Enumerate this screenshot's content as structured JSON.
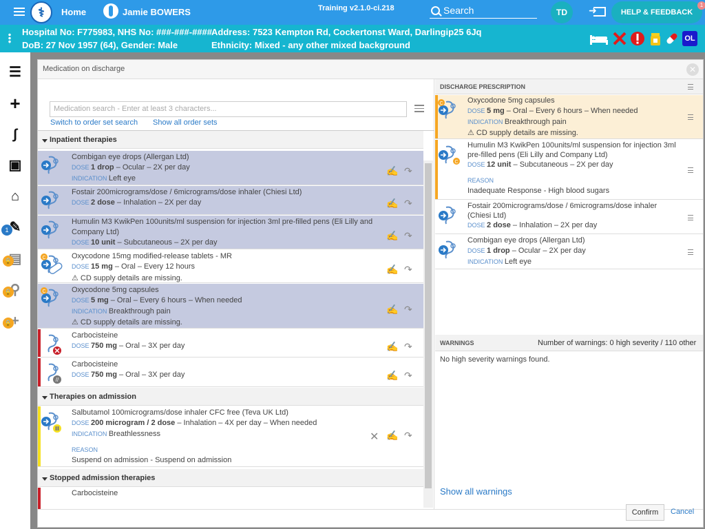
{
  "header": {
    "home_label": "Home",
    "user_name": "Jamie BOWERS",
    "training_label": "Training v2.1.0-ci.218",
    "search_label": "Search",
    "user_initials": "TD",
    "help_label": "HELP & FEEDBACK",
    "help_badge": "1"
  },
  "patient": {
    "hospital_line": "Hospital No: F775983, NHS No: ###-###-####",
    "dob_line": "DoB: 27 Nov 1957 (64), Gender: Male",
    "address_line": "Address: 7523 Kempton Rd, Cockertonst Ward, Darlingip25 6Jq",
    "ethnicity_line": "Ethnicity: Mixed - any other mixed background",
    "ol_badge": "OL"
  },
  "sidebar": {
    "badge_count": "1"
  },
  "modal": {
    "title": "Medication on discharge",
    "search_placeholder": "Medication search - Enter at least 3 characters...",
    "link_order_set_search": "Switch to order set search",
    "link_show_all_order_sets": "Show all order sets",
    "sections": {
      "inpatient": "Inpatient therapies",
      "admission": "Therapies on admission",
      "stopped": "Stopped admission therapies"
    },
    "dose_label": "DOSE",
    "indication_label": "INDICATION",
    "reason_label": "REASON",
    "inpatient_rows": [
      {
        "name": "Combigan eye drops (Allergan Ltd)",
        "dose": "1 drop",
        "dose_rest": " – Ocular – 2X per day",
        "indication": "Left eye"
      },
      {
        "name": "Fostair 200micrograms/dose / 6micrograms/dose inhaler (Chiesi Ltd)",
        "dose": "2 dose",
        "dose_rest": " – Inhalation – 2X per day"
      },
      {
        "name": "Humulin M3 KwikPen 100units/ml suspension for injection 3ml pre-filled pens (Eli Lilly and",
        "name2": "Company Ltd)",
        "dose": "10 unit",
        "dose_rest": " – Subcutaneous – 2X per day"
      },
      {
        "name": "Oxycodone 15mg modified-release tablets - MR",
        "dose": "15 mg",
        "dose_rest": " – Oral – Every 12 hours",
        "warning": "CD supply details are missing."
      },
      {
        "name": "Oxycodone 5mg capsules",
        "dose": "5 mg",
        "dose_rest": " – Oral – Every 6 hours – When needed",
        "indication": "Breakthrough pain",
        "warning": "CD supply details are missing."
      },
      {
        "name": "Carbocisteine",
        "dose": "750 mg",
        "dose_rest": " – Oral – 3X per day"
      },
      {
        "name": "Carbocisteine",
        "dose": "750 mg",
        "dose_rest": " – Oral – 3X per day"
      }
    ],
    "admission_rows": [
      {
        "name": "Salbutamol 100micrograms/dose inhaler CFC free (Teva UK Ltd)",
        "dose": "200 microgram / 2 dose",
        "dose_rest": " – Inhalation – 4X per day – When needed",
        "indication": "Breathlessness",
        "reason": "Suspend on admission - Suspend on admission"
      }
    ],
    "stopped_rows": [
      {
        "name": "Carbocisteine"
      }
    ],
    "discharge": {
      "title": "DISCHARGE PRESCRIPTION",
      "rows": [
        {
          "name": "Oxycodone 5mg capsules",
          "dose": "5 mg",
          "dose_rest": " – Oral – Every 6 hours – When needed",
          "indication": "Breakthrough pain",
          "warning": "CD supply details are missing."
        },
        {
          "name": "Humulin M3 KwikPen 100units/ml suspension for injection 3ml",
          "name2": "pre-filled pens (Eli Lilly and Company Ltd)",
          "dose": "12 unit",
          "dose_rest": " – Subcutaneous – 2X per day",
          "reason": "Inadequate Response - High blood sugars"
        },
        {
          "name": "Fostair 200micrograms/dose / 6micrograms/dose inhaler",
          "name2": "(Chiesi Ltd)",
          "dose": "2 dose",
          "dose_rest": " – Inhalation – 2X per day"
        },
        {
          "name": "Combigan eye drops (Allergan Ltd)",
          "dose": "1 drop",
          "dose_rest": " – Ocular – 2X per day",
          "indication": "Left eye"
        }
      ]
    },
    "warnings": {
      "title": "WARNINGS",
      "summary": "Number of warnings: 0 high severity / 110 other",
      "message": "No high severity warnings found.",
      "show_all": "Show all warnings"
    },
    "confirm_label": "Confirm",
    "cancel_label": "Cancel"
  }
}
